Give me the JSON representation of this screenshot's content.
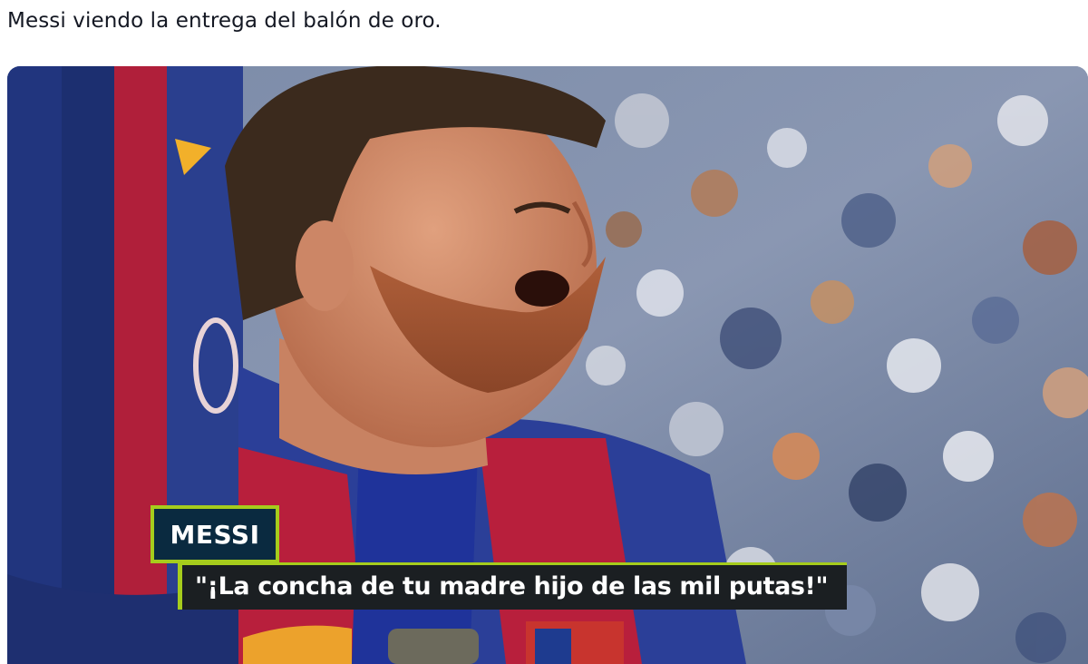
{
  "post": {
    "text": "Messi viendo la entrega del balón de oro."
  },
  "media": {
    "description_icon": "photo-image",
    "caption": {
      "name": "MESSI",
      "quote": "\"¡La concha de tu madre hijo de las mil putas!\""
    },
    "colors": {
      "caption_accent": "#a6cc1c",
      "name_bg": "#0a2a40",
      "quote_bg": "#1b1f22"
    }
  }
}
